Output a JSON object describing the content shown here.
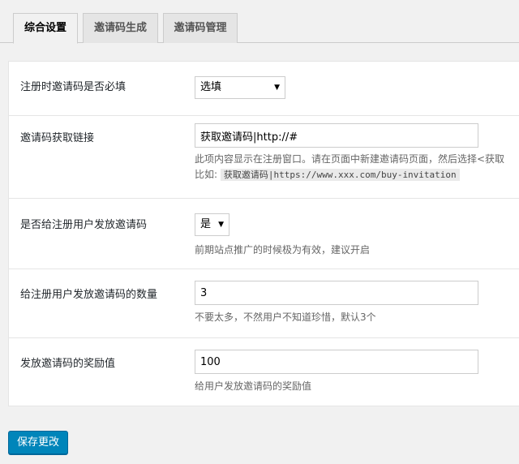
{
  "tabs": [
    {
      "label": "综合设置",
      "active": true
    },
    {
      "label": "邀请码生成",
      "active": false
    },
    {
      "label": "邀请码管理",
      "active": false
    }
  ],
  "settings": {
    "required": {
      "label": "注册时邀请码是否必填",
      "value": "选填"
    },
    "link": {
      "label": "邀请码获取链接",
      "value": "获取邀请码|http://#",
      "desc_line1": "此项内容显示在注册窗口。请在页面中新建邀请码页面，然后选择<获取",
      "desc_prefix": "比如:",
      "desc_code": "获取邀请码|https://www.xxx.com/buy-invitation"
    },
    "grant": {
      "label": "是否给注册用户发放邀请码",
      "value": "是",
      "desc": "前期站点推广的时候极为有效，建议开启"
    },
    "count": {
      "label": "给注册用户发放邀请码的数量",
      "value": "3",
      "desc": "不要太多，不然用户不知道珍惜，默认3个"
    },
    "reward": {
      "label": "发放邀请码的奖励值",
      "value": "100",
      "desc": "给用户发放邀请码的奖励值"
    }
  },
  "save_label": "保存更改"
}
